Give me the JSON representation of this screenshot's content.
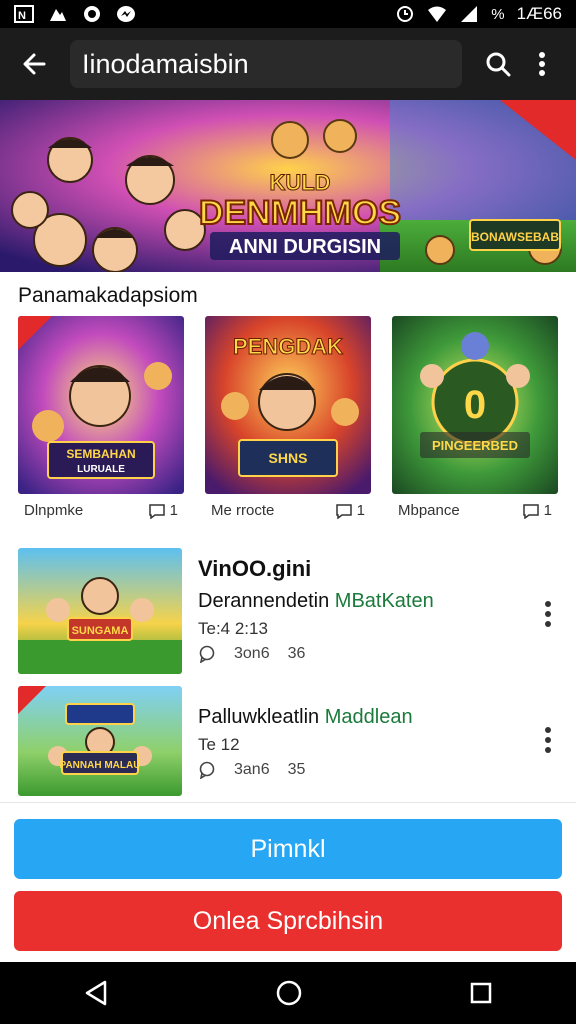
{
  "status_bar": {
    "battery_text": "%",
    "time": "1Æ66",
    "left_icons": [
      "notification-icon",
      "photo-icon",
      "whatsapp-icon",
      "messenger-icon"
    ],
    "right_icons": [
      "alarm-icon",
      "wifi-icon",
      "signal-icon"
    ]
  },
  "app_bar": {
    "search_text": "Iinodamaisbin",
    "back_icon": "arrow-left-icon",
    "search_icon": "search-icon",
    "menu_icon": "more-vert-icon"
  },
  "hero": {
    "headline_top": "KULD",
    "headline_main": "DENMHMOS",
    "headline_sub": "ANNI DURGISIN",
    "side_badge": "BONAWSEBAB"
  },
  "section": {
    "title": "Panamakadapsiom"
  },
  "cards": [
    {
      "thumb_title": "SEMBAHAN",
      "thumb_sub": "LURUALE",
      "label": "Dlnpmke",
      "count": "1"
    },
    {
      "thumb_title": "PENGDAK",
      "thumb_sub": "SHNS",
      "label": "Me rrocte",
      "count": "1"
    },
    {
      "thumb_title": "PINGEERBED",
      "thumb_sub": "0",
      "label": "Mbpance",
      "count": "1"
    }
  ],
  "list_items": [
    {
      "title": "VinOO.gini",
      "subtitle": "Derannendetin ",
      "subtitle_accent": "MBatKaten",
      "time": "Te:4 2:13",
      "views": "3on6",
      "likes": "36",
      "thumb_text": "SUNGAMA"
    },
    {
      "title": "",
      "subtitle": "Palluwkleatlin ",
      "subtitle_accent": "Maddlean",
      "time": "Te 12",
      "views": "3an6",
      "likes": "35",
      "thumb_text": "PANNAH MALAU"
    }
  ],
  "buttons": {
    "primary": "Pimnkl",
    "danger": "Onlea Sprcbihsin"
  },
  "colors": {
    "primary": "#26a6f3",
    "danger": "#e9302e",
    "accent_text": "#1b7a3b",
    "app_bar": "#1c1c1c"
  },
  "nav": {
    "back_icon": "nav-back-icon",
    "home_icon": "nav-home-icon",
    "recents_icon": "nav-recents-icon"
  }
}
